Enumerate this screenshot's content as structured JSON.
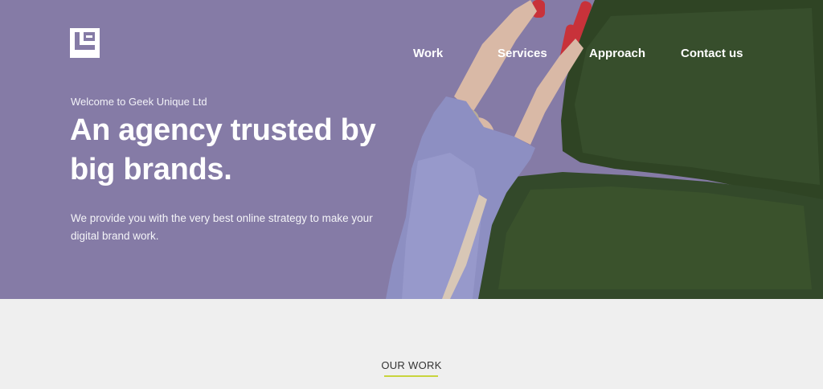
{
  "brand": {
    "logo_icon": "geek-unique-logo-icon"
  },
  "nav": {
    "items": [
      {
        "label": "Work"
      },
      {
        "label": "Services"
      },
      {
        "label": "Approach"
      },
      {
        "label": "Contact us"
      }
    ]
  },
  "hero": {
    "eyebrow": "Welcome to Geek Unique Ltd",
    "headline": "An agency trusted by big brands.",
    "description": "We provide you with the very best online strategy to make your digital brand work.",
    "image": "woman-trimming-hedge-photo"
  },
  "section": {
    "title": "OUR WORK"
  },
  "colors": {
    "hero_bg": "#857ba6",
    "accent": "#c8d43c",
    "section_bg": "#efefef"
  }
}
